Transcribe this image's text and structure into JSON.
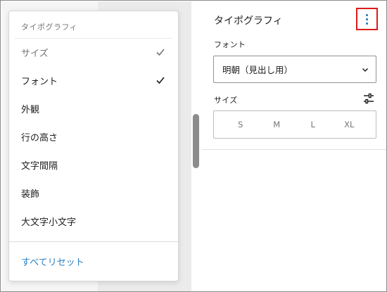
{
  "menu": {
    "heading": "タイポグラフィ",
    "items": [
      {
        "label": "サイズ",
        "checked": true,
        "state": "disabled"
      },
      {
        "label": "フォント",
        "checked": true,
        "state": "enabled"
      },
      {
        "label": "外観",
        "checked": false,
        "state": "enabled"
      },
      {
        "label": "行の高さ",
        "checked": false,
        "state": "enabled"
      },
      {
        "label": "文字間隔",
        "checked": false,
        "state": "enabled"
      },
      {
        "label": "装飾",
        "checked": false,
        "state": "enabled"
      },
      {
        "label": "大文字小文字",
        "checked": false,
        "state": "enabled"
      }
    ],
    "reset_label": "すべてリセット"
  },
  "panel": {
    "title": "タイポグラフィ",
    "options_icon": "vertical-ellipsis-icon",
    "font": {
      "label": "フォント",
      "value": "明朝（見出し用）",
      "icon": "chevron-down-icon"
    },
    "size": {
      "label": "サイズ",
      "custom_icon": "sliders-icon",
      "options": [
        "S",
        "M",
        "L",
        "XL"
      ]
    }
  },
  "colors": {
    "accent": "#2271b1",
    "link": "#2a7fc0",
    "highlight_border": "#e0191a"
  }
}
